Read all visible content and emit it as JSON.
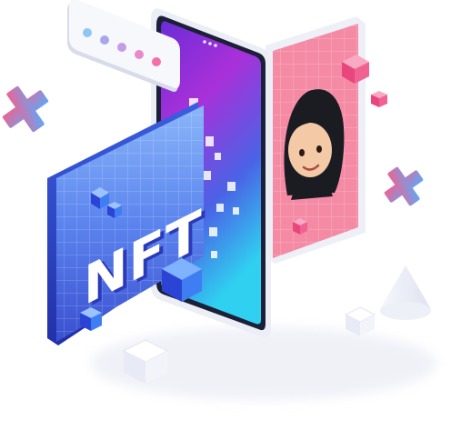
{
  "illustration": {
    "nft_card": {
      "label": "NFT"
    },
    "chat_bubble": {
      "dot_colors": [
        "#8fc6f5",
        "#a9a5ee",
        "#c69ce8",
        "#e889cc",
        "#f56fa6"
      ]
    },
    "colors": {
      "phone_gradient": [
        "#6a2dd6",
        "#a930d9",
        "#4a63e6",
        "#2fd0f0"
      ],
      "nft_card_gradient": [
        "#7aaaf8",
        "#4e74e8",
        "#3443c9"
      ],
      "avatar_card": "#f58aa5",
      "accent_pink": "#f06292",
      "accent_blue": "#3f7ef2"
    }
  }
}
